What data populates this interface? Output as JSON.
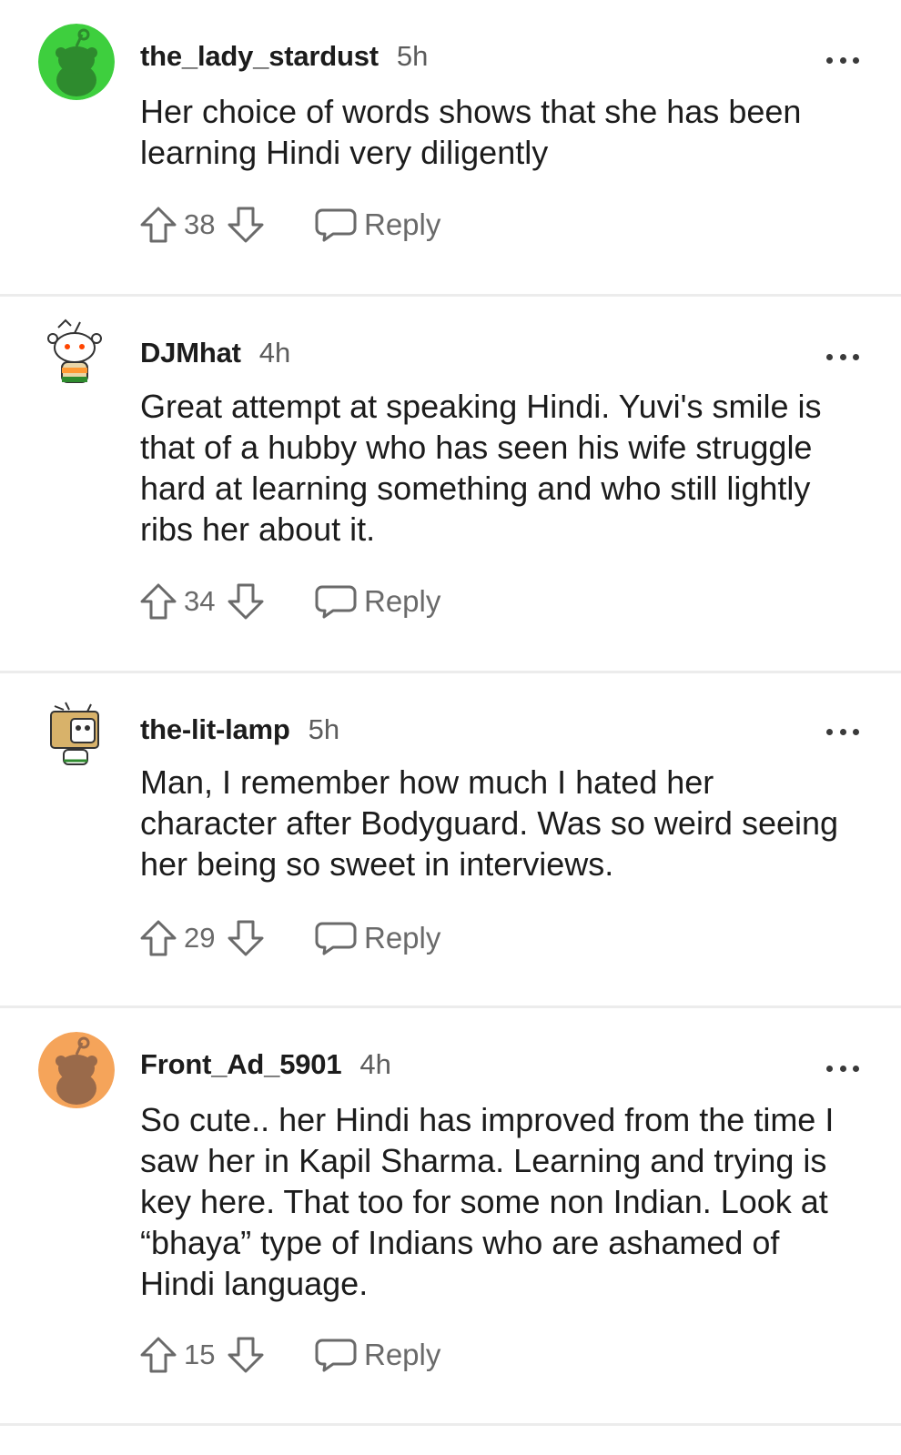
{
  "comments": [
    {
      "username": "the_lady_stardust",
      "time": "5h",
      "text": "Her choice of words shows that she has been learning Hindi very diligently",
      "score": "38",
      "reply_label": "Reply",
      "avatar": {
        "type": "snoo-circle",
        "bg": "#3ecf3e",
        "snoo": "#2e8b2e"
      }
    },
    {
      "username": "DJMhat",
      "time": "4h",
      "text": "Great attempt at speaking Hindi. Yuvi's smile is that of a hubby who has seen his wife struggle hard at learning something and who still lightly ribs her about it.",
      "score": "34",
      "reply_label": "Reply",
      "avatar": {
        "type": "snoo-custom",
        "accent": "#ff4500"
      }
    },
    {
      "username": "the-lit-lamp",
      "time": "5h",
      "text": "Man, I remember how much I hated her character after Bodyguard. Was so weird seeing her being so sweet in interviews.",
      "score": "29",
      "reply_label": "Reply",
      "avatar": {
        "type": "snoo-box",
        "accent": "#d8b26a"
      }
    },
    {
      "username": "Front_Ad_5901",
      "time": "4h",
      "text": "So cute.. her Hindi has improved from the time I saw her in Kapil Sharma. Learning and trying is key here. That too for some non Indian. Look at “bhaya” type of Indians who are ashamed of Hindi language.",
      "score": "15",
      "reply_label": "Reply",
      "avatar": {
        "type": "snoo-circle",
        "bg": "#f5a45a",
        "snoo": "#9a6a4a"
      }
    }
  ],
  "icons": {
    "upvote": "arrow-up-outline-icon",
    "downvote": "arrow-down-outline-icon",
    "reply": "speech-bubble-icon",
    "more": "more-horizontal-icon"
  }
}
